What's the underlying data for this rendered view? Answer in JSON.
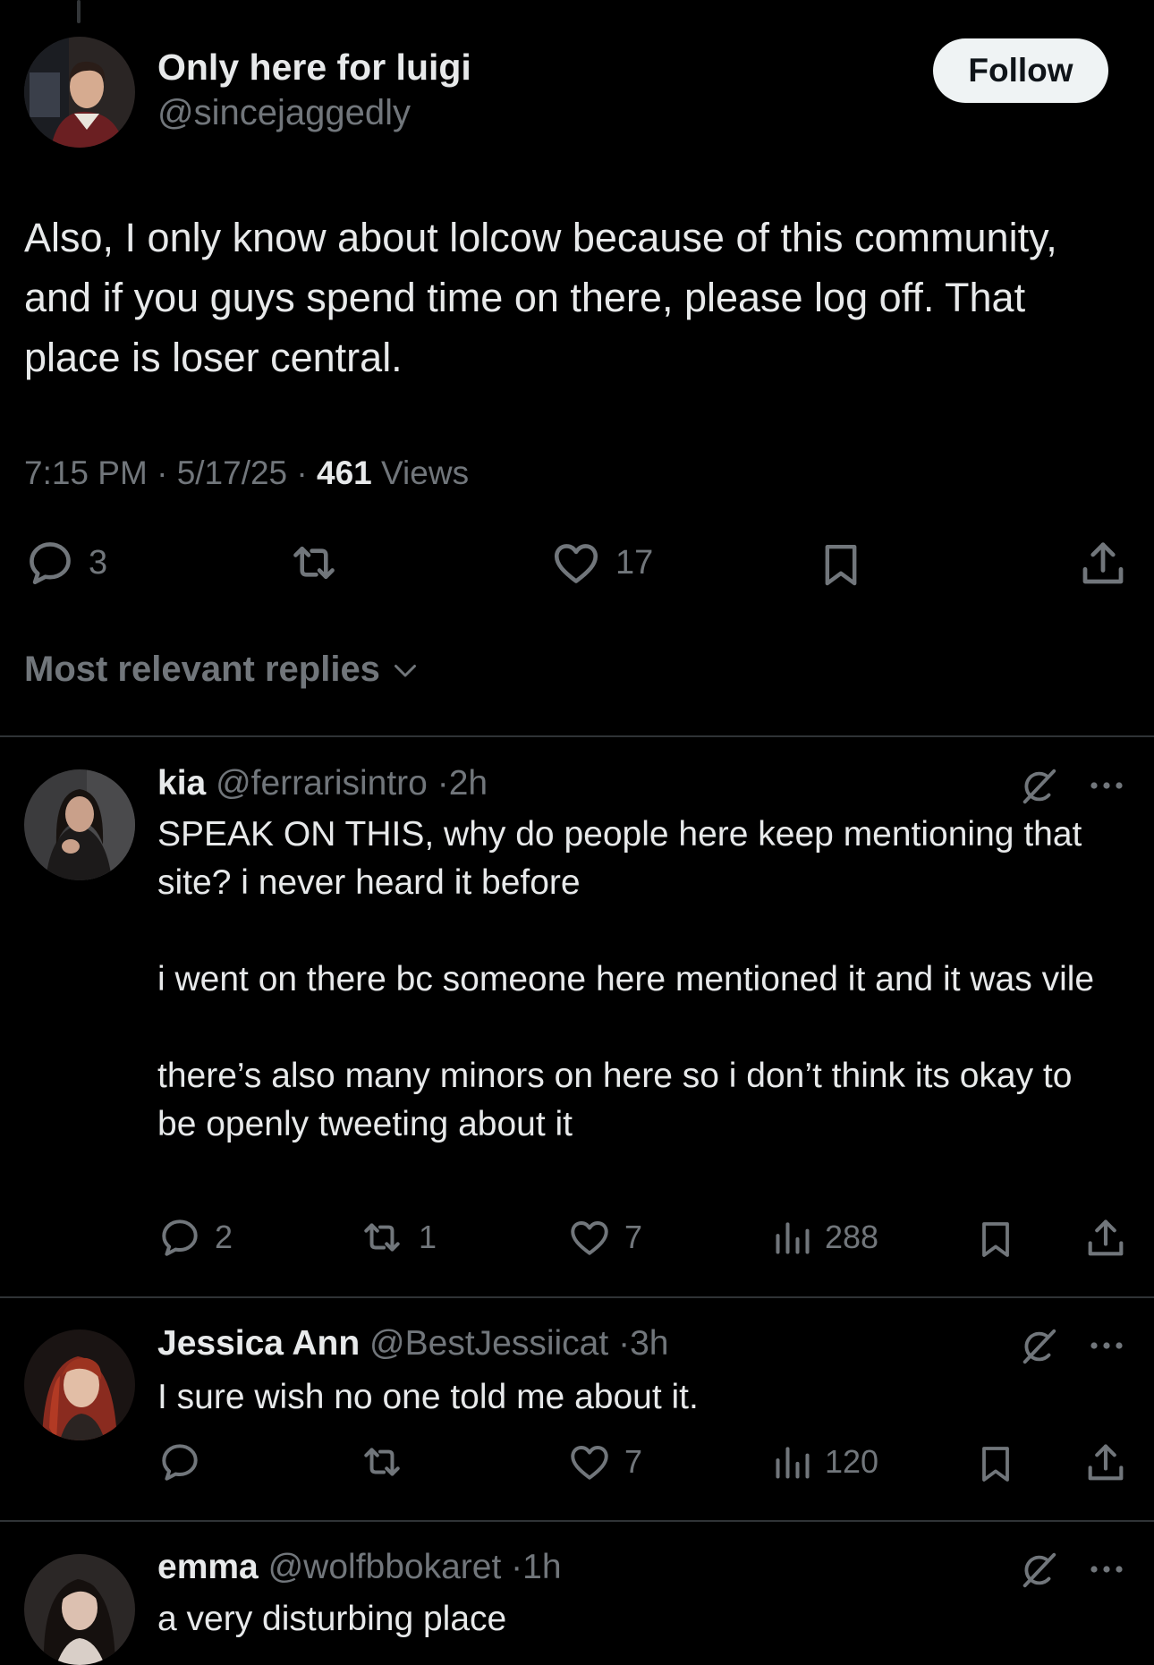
{
  "main_tweet": {
    "name": "Only here for luigi",
    "handle": "@sincejaggedly",
    "follow_label": "Follow",
    "text": "Also, I only know about lolcow because of this community, and if you guys spend time on there, please log off. That place is loser central.",
    "time": "7:15 PM",
    "date": "5/17/25",
    "views_count": "461",
    "views_label": "Views",
    "replies": "3",
    "likes": "17"
  },
  "sort_label": "Most relevant replies",
  "replies": [
    {
      "name": "kia",
      "handle": "@ferrarisintro",
      "age": "2h",
      "text": "SPEAK ON THIS, why do people here keep mentioning that site? i never heard it before\n\ni went on there bc someone here mentioned it and it was vile\n\nthere’s also many minors on here so i don’t think its okay to be openly tweeting about it",
      "replies": "2",
      "reposts": "1",
      "likes": "7",
      "views": "288"
    },
    {
      "name": "Jessica Ann",
      "handle": "@BestJessiicat",
      "age": "3h",
      "text": "I sure wish no one told me about it.",
      "likes": "7",
      "views": "120"
    },
    {
      "name": "emma",
      "handle": "@wolfbbokaret",
      "age": "1h",
      "text": "a very disturbing place"
    }
  ],
  "colors": {
    "background": "#000000",
    "text": "#e7e9ea",
    "muted": "#71767b",
    "divider": "#2f3336",
    "button": "#eff3f4"
  },
  "icons": [
    "reply-icon",
    "repost-icon",
    "like-icon",
    "bookmark-icon",
    "share-icon",
    "views-icon",
    "grok-icon",
    "more-icon",
    "chevron-down-icon"
  ]
}
